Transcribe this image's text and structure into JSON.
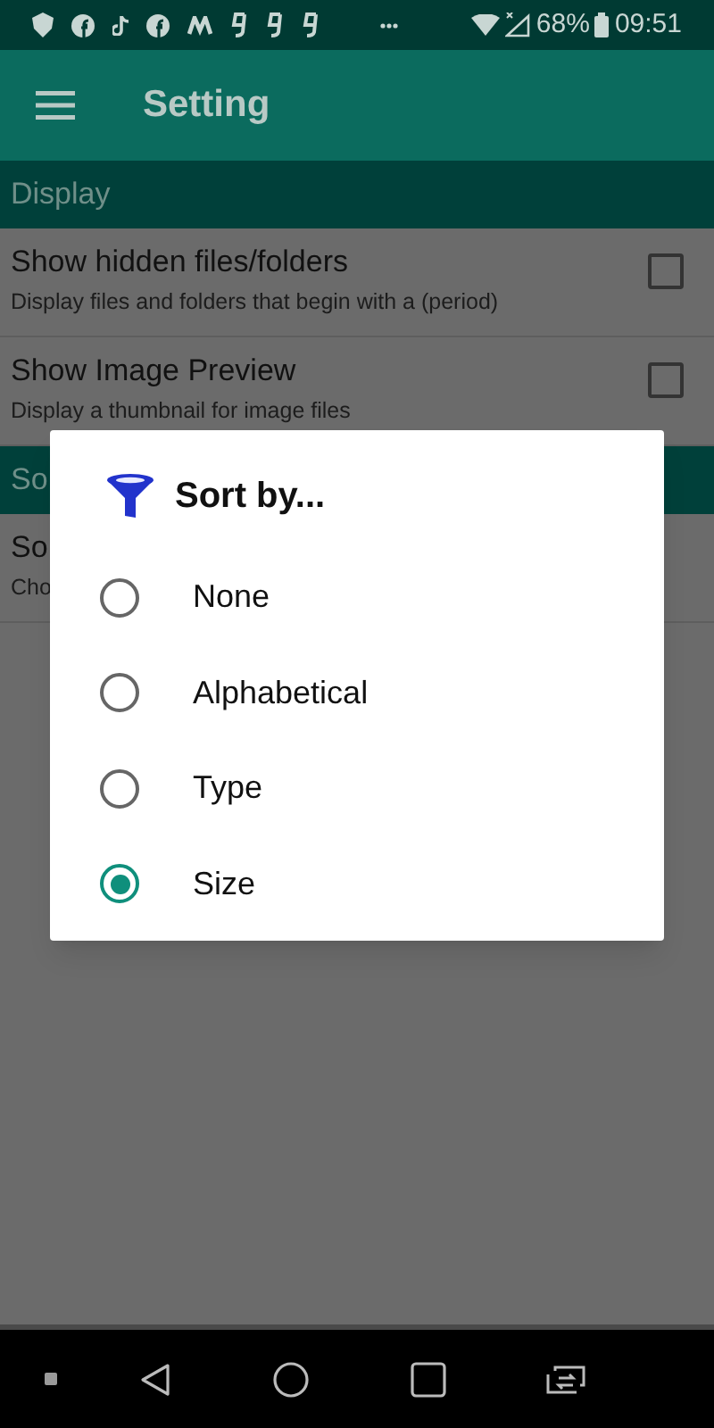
{
  "status_bar": {
    "battery": "68%",
    "time": "09:51"
  },
  "app_bar": {
    "title": "Setting"
  },
  "sections": [
    {
      "header": "Display",
      "items": [
        {
          "title": "Show hidden files/folders",
          "subtitle": "Display files and folders that begin with a (period)",
          "checked": false
        },
        {
          "title": "Show Image Preview",
          "subtitle": "Display a thumbnail for image files",
          "checked": false
        }
      ]
    },
    {
      "header": "So",
      "items": [
        {
          "title": "So",
          "subtitle": "Cho"
        }
      ]
    }
  ],
  "dialog": {
    "title": "Sort by...",
    "options": [
      {
        "label": "None",
        "selected": false
      },
      {
        "label": "Alphabetical",
        "selected": false
      },
      {
        "label": "Type",
        "selected": false
      },
      {
        "label": "Size",
        "selected": true
      }
    ]
  }
}
